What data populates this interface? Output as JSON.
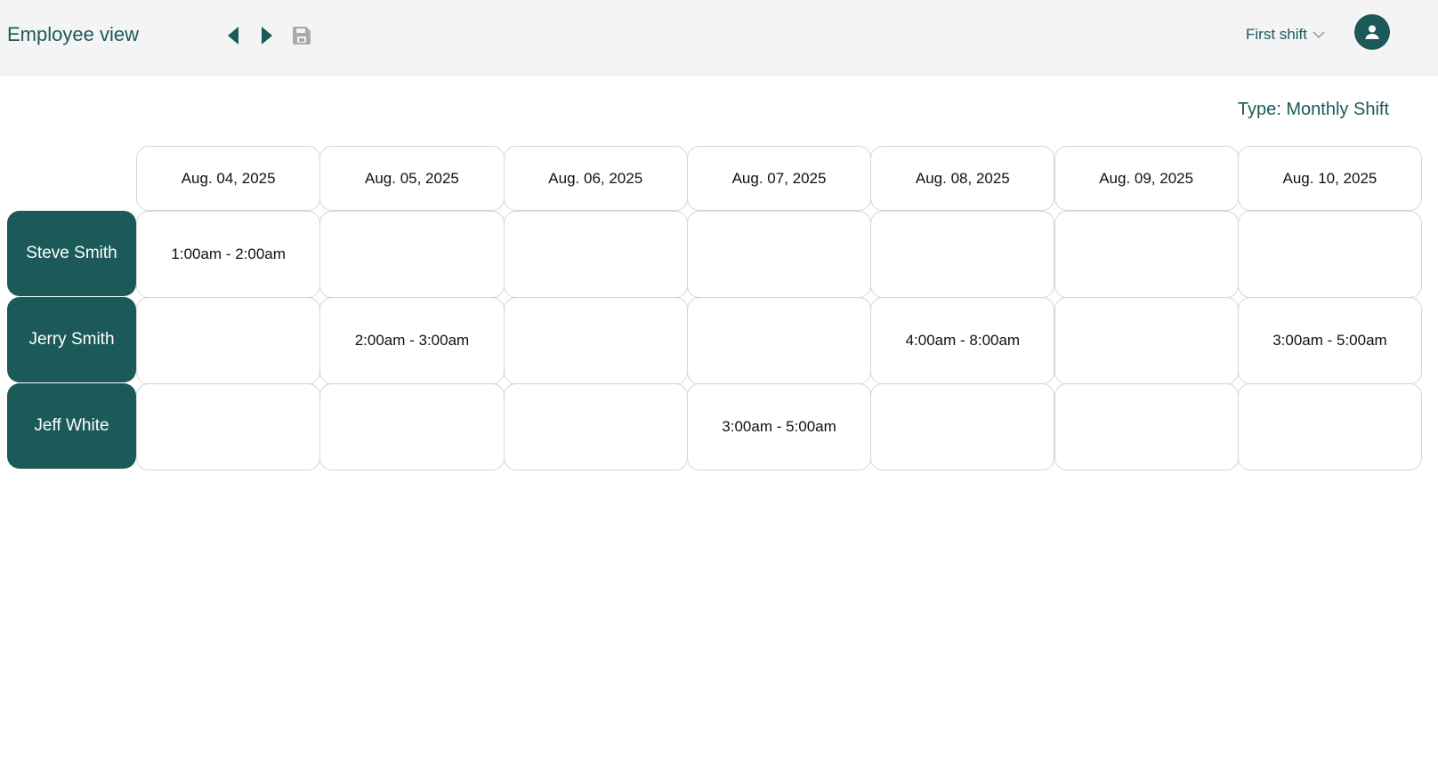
{
  "header": {
    "title": "Employee view",
    "shift_selected": "First shift"
  },
  "type_label": "Type: Monthly Shift",
  "dates": [
    "Aug. 04, 2025",
    "Aug. 05, 2025",
    "Aug. 06, 2025",
    "Aug. 07, 2025",
    "Aug. 08, 2025",
    "Aug. 09, 2025",
    "Aug. 10, 2025"
  ],
  "employees": [
    {
      "name": "Steve Smith",
      "shifts": [
        "1:00am - 2:00am",
        "",
        "",
        "",
        "",
        "",
        ""
      ]
    },
    {
      "name": "Jerry Smith",
      "shifts": [
        "",
        "2:00am - 3:00am",
        "",
        "",
        "4:00am - 8:00am",
        "",
        "3:00am - 5:00am"
      ]
    },
    {
      "name": "Jeff White",
      "shifts": [
        "",
        "",
        "",
        "3:00am - 5:00am",
        "",
        "",
        ""
      ]
    }
  ],
  "colors": {
    "accent": "#1b5a58",
    "header_bg": "#f4f4f4",
    "save_icon_disabled": "#aaaaaa"
  },
  "icons": {
    "prev": "caret-left-icon",
    "next": "caret-right-icon",
    "save": "floppy-disk-icon",
    "shift_dropdown": "chevron-down-icon",
    "avatar": "user-icon"
  }
}
